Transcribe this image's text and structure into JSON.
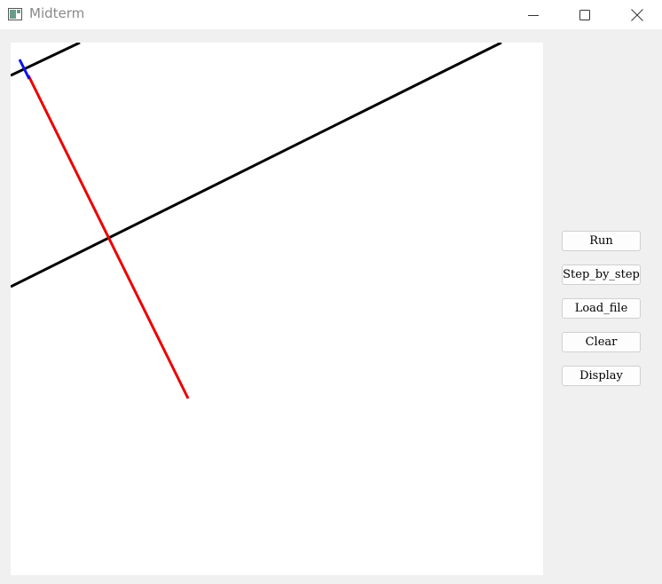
{
  "window": {
    "title": "Midterm"
  },
  "buttons": {
    "run": "Run",
    "step": "Step_by_step",
    "load": "Load_file",
    "clear": "Clear",
    "display": "Display"
  },
  "colors": {
    "title_text": "#8a8a8a",
    "black_line": "#000000",
    "red_line": "#ee0000",
    "blue_line": "#1010ee",
    "panel_bg": "#f0f0f0",
    "canvas_bg": "#ffffff"
  },
  "icons": {
    "app": "app-window-icon",
    "minimize": "minimize-icon",
    "maximize": "maximize-icon",
    "close": "close-icon"
  }
}
